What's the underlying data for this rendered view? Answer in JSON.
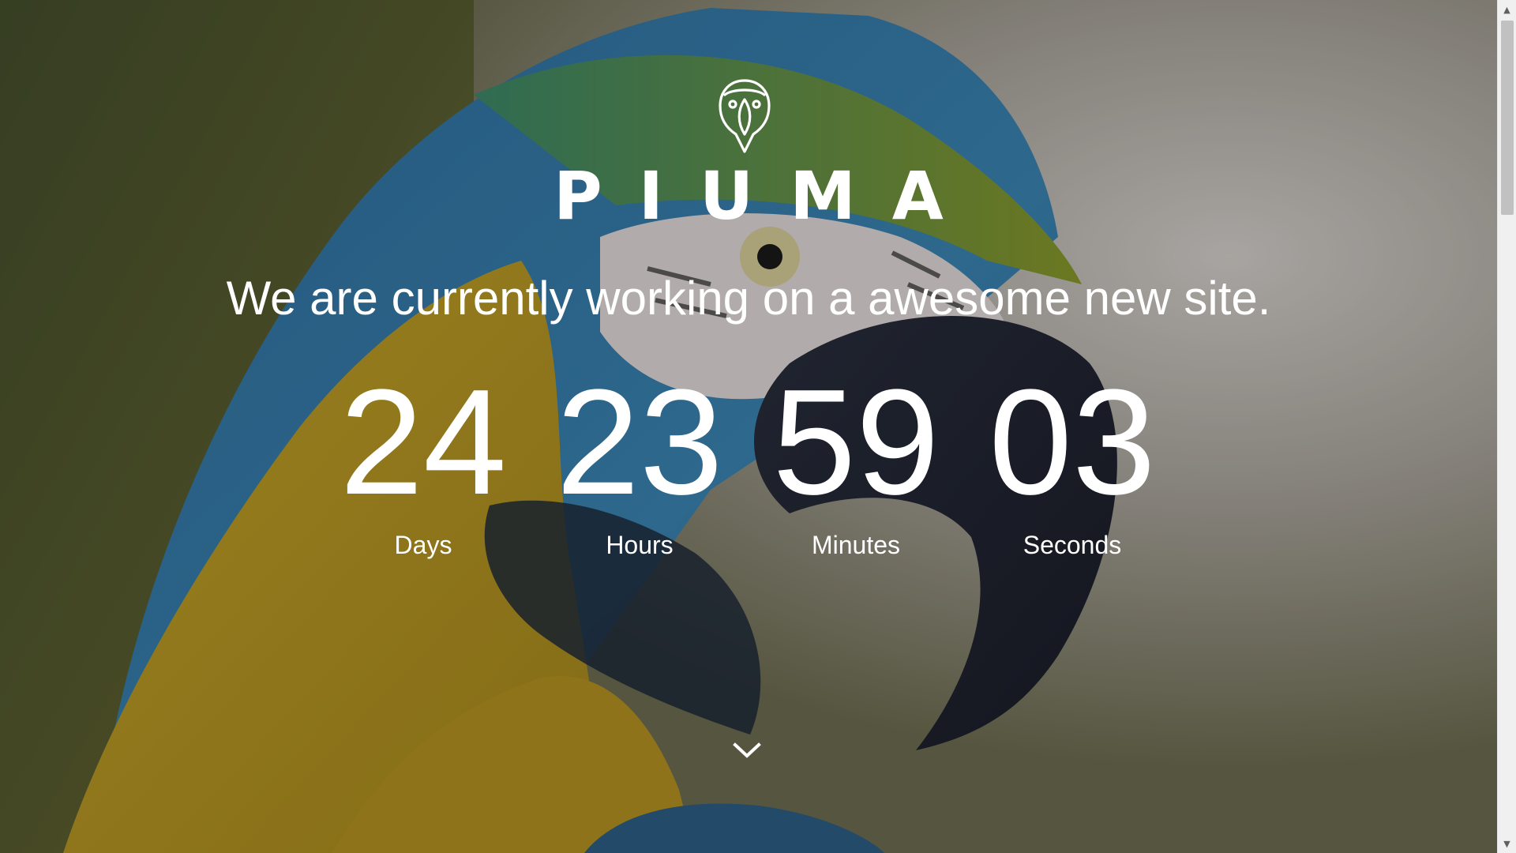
{
  "brand": {
    "name": "PIUMA",
    "logo_icon": "parrot-logo-icon"
  },
  "hero": {
    "tagline": "We are currently working on a awesome new site."
  },
  "countdown": {
    "days": {
      "value": "24",
      "label": "Days"
    },
    "hours": {
      "value": "23",
      "label": "Hours"
    },
    "minutes": {
      "value": "59",
      "label": "Minutes"
    },
    "seconds": {
      "value": "03",
      "label": "Seconds"
    }
  },
  "scroll_down_icon": "chevron-down-icon",
  "colors": {
    "text": "#ffffff",
    "scrollbar_track": "#f0f0f0",
    "scrollbar_thumb": "#c1c1c1"
  }
}
